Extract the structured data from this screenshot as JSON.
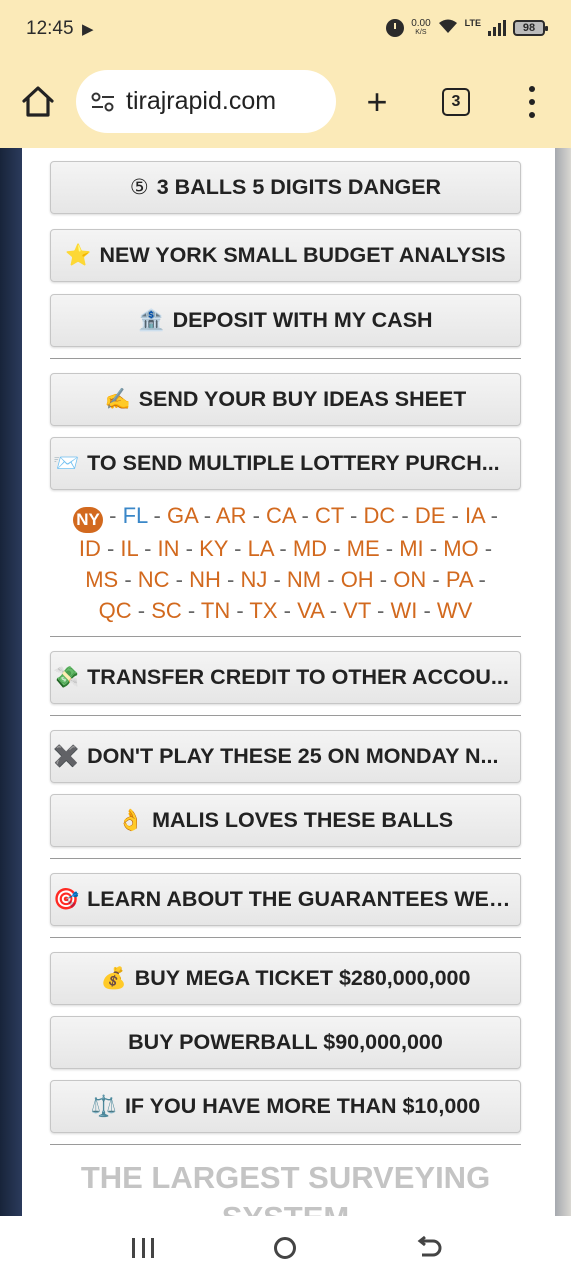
{
  "status_bar": {
    "time": "12:45",
    "net_speed_value": "0.00",
    "net_speed_unit": "K/S",
    "network_type": "LTE",
    "battery_level": "98"
  },
  "browser": {
    "url": "tirajrapid.com",
    "tab_count": "3",
    "new_tab_label": "+"
  },
  "buttons": [
    {
      "emoji": "⑤",
      "label": "3 BALLS 5 DIGITS DANGER"
    },
    {
      "emoji": "⭐",
      "label": "NEW YORK SMALL BUDGET ANALYSIS"
    },
    {
      "emoji": "🏦",
      "label": "DEPOSIT WITH MY CASH"
    },
    {
      "emoji": "✍️",
      "label": "SEND YOUR BUY IDEAS SHEET"
    },
    {
      "emoji": "📨",
      "label": "TO SEND MULTIPLE LOTTERY PURCH..."
    },
    {
      "emoji": "💸",
      "label": "TRANSFER CREDIT TO OTHER ACCOU..."
    },
    {
      "emoji": "✖️",
      "label": "DON'T PLAY THESE 25 ON MONDAY N..."
    },
    {
      "emoji": "👌",
      "label": "MALIS LOVES THESE BALLS"
    },
    {
      "emoji": "🎯",
      "label": "LEARN ABOUT THE GUARANTEES WE ..."
    },
    {
      "emoji": "💰",
      "label": "BUY MEGA TICKET $280,000,000"
    },
    {
      "emoji": "",
      "label": "BUY POWERBALL $90,000,000"
    },
    {
      "emoji": "⚖️",
      "label": "IF YOU HAVE MORE THAN $10,000"
    }
  ],
  "states": {
    "current": "NY",
    "list": [
      "FL",
      "GA",
      "AR",
      "CA",
      "CT",
      "DC",
      "DE",
      "IA",
      "ID",
      "IL",
      "IN",
      "KY",
      "LA",
      "MD",
      "ME",
      "MI",
      "MO",
      "MS",
      "NC",
      "NH",
      "NJ",
      "NM",
      "OH",
      "ON",
      "PA",
      "QC",
      "SC",
      "TN",
      "TX",
      "VA",
      "VT",
      "WI",
      "WV"
    ]
  },
  "heading": {
    "text": "THE LARGEST SURVEYING SYSTEM"
  }
}
